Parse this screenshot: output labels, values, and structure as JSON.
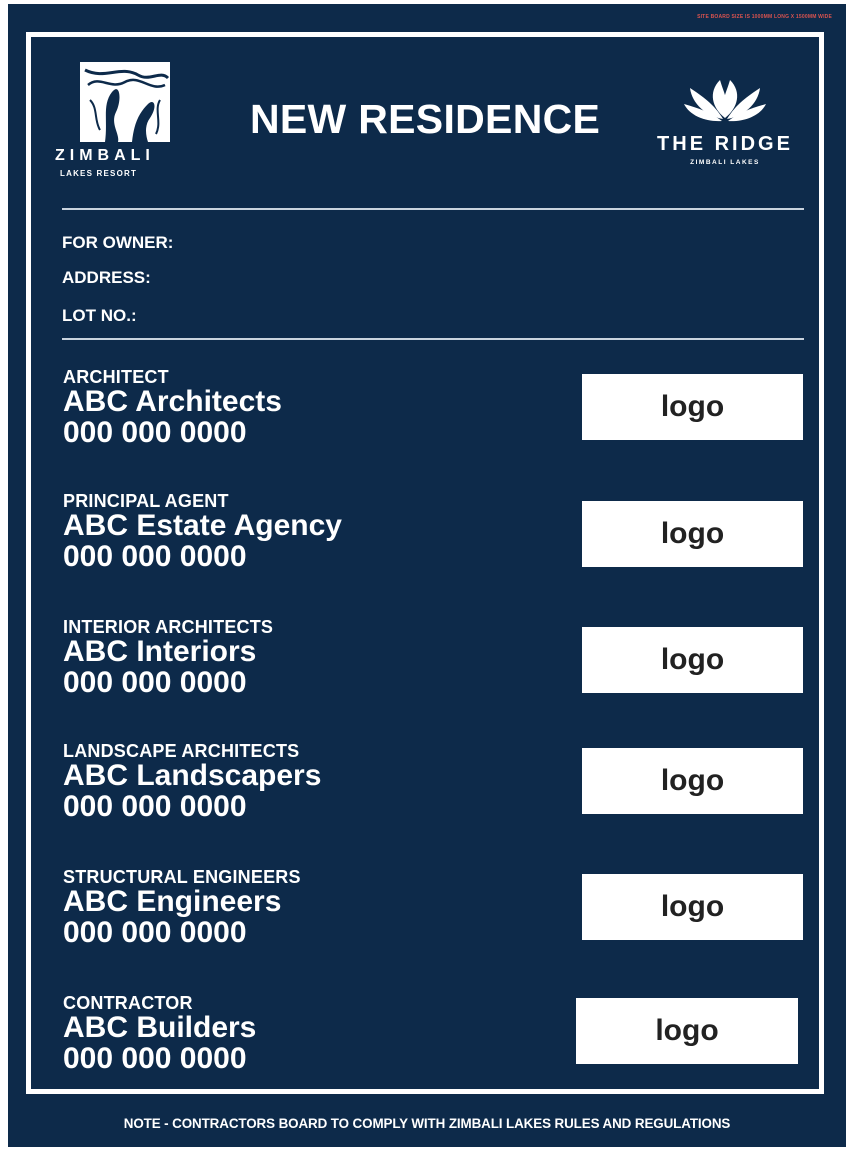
{
  "header": {
    "title": "NEW RESIDENCE",
    "tiny_note": "SITE BOARD SIZE IS 1000MM LONG X 1500MM WIDE",
    "left_logo": {
      "name": "ZIMBALI",
      "sub": "LAKES RESORT"
    },
    "right_logo": {
      "name": "THE RIDGE",
      "sub": "ZIMBALI LAKES"
    }
  },
  "fields": [
    {
      "label": "FOR OWNER:"
    },
    {
      "label": "ADDRESS:"
    },
    {
      "label": "LOT NO.:"
    }
  ],
  "entries": [
    {
      "role": "ARCHITECT",
      "company": "ABC Architects",
      "phone": "000 000 0000",
      "logo": "logo"
    },
    {
      "role": "PRINCIPAL AGENT",
      "company": "ABC Estate Agency",
      "phone": "000 000 0000",
      "logo": "logo"
    },
    {
      "role": "INTERIOR ARCHITECTS",
      "company": "ABC Interiors",
      "phone": "000 000 0000",
      "logo": "logo"
    },
    {
      "role": "LANDSCAPE ARCHITECTS",
      "company": "ABC Landscapers",
      "phone": "000 000 0000",
      "logo": "logo"
    },
    {
      "role": "STRUCTURAL ENGINEERS",
      "company": "ABC Engineers",
      "phone": "000 000 0000",
      "logo": "logo"
    },
    {
      "role": "CONTRACTOR",
      "company": "ABC Builders",
      "phone": "000 000 0000",
      "logo": "logo"
    }
  ],
  "footer": {
    "note": "NOTE - CONTRACTORS BOARD TO COMPLY WITH ZIMBALI LAKES RULES AND REGULATIONS"
  },
  "colors": {
    "board": "#0d2a4a",
    "text": "#ffffff",
    "logo_box": "#ffffff"
  }
}
